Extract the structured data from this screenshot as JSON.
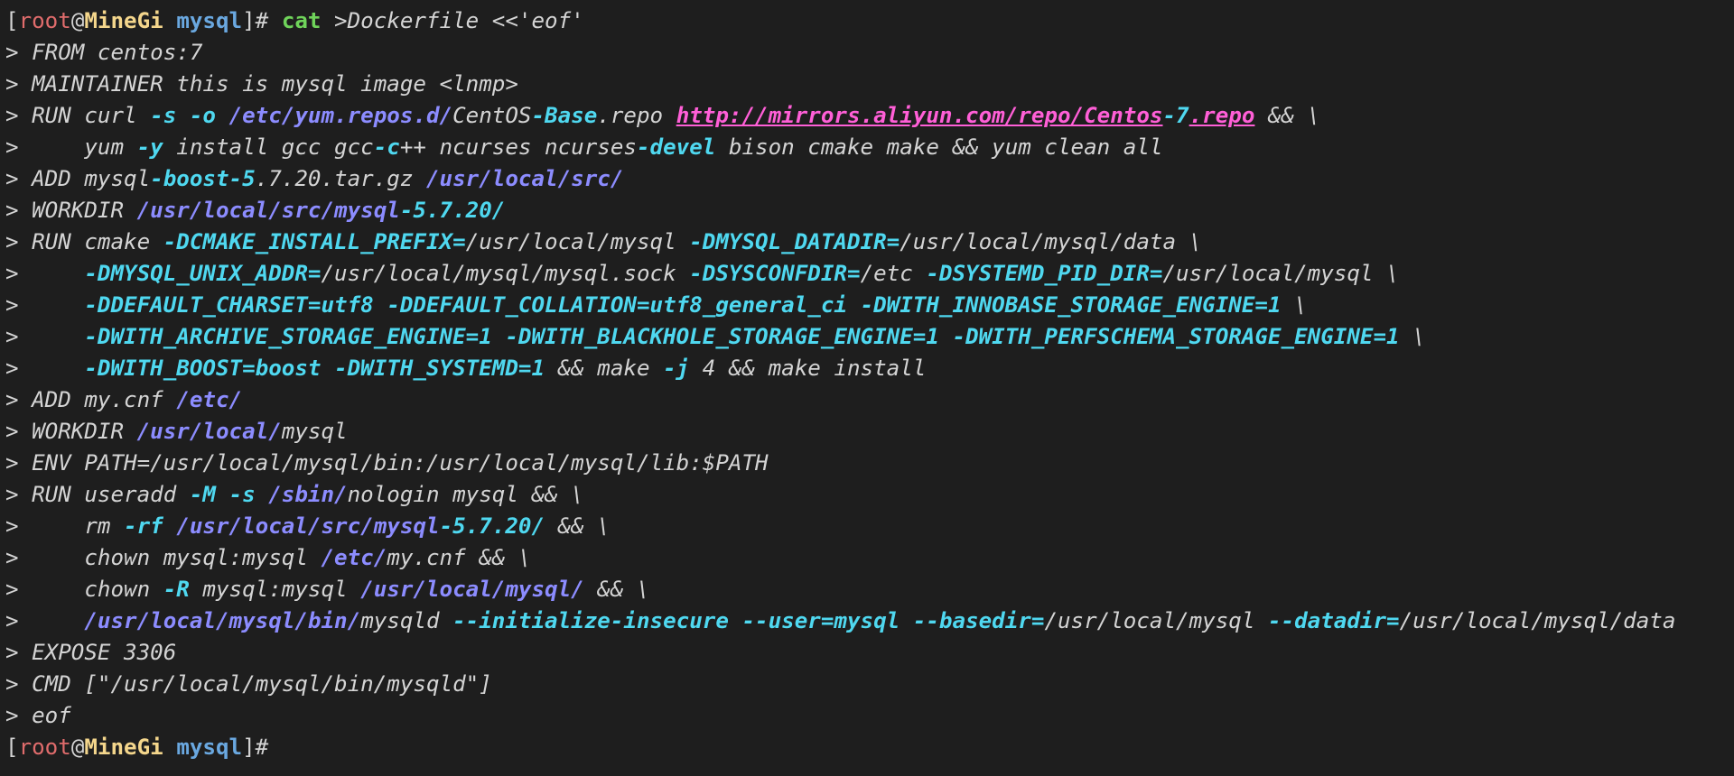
{
  "terminal": {
    "lines": [
      [
        [
          "br",
          "["
        ],
        [
          "r",
          "root"
        ],
        [
          "w",
          "@"
        ],
        [
          "y",
          "MineGi"
        ],
        [
          "w",
          " "
        ],
        [
          "b",
          "mysql"
        ],
        [
          "br",
          "]# "
        ],
        [
          "g",
          "cat"
        ],
        [
          "t",
          " >Dockerfile <<'eof'"
        ]
      ],
      [
        [
          "t",
          "> FROM centos:7"
        ]
      ],
      [
        [
          "t",
          "> MAINTAINER this is mysql image <lnmp>"
        ]
      ],
      [
        [
          "t",
          "> RUN curl "
        ],
        [
          "c",
          "-s"
        ],
        [
          "t",
          " "
        ],
        [
          "c",
          "-o"
        ],
        [
          "t",
          " "
        ],
        [
          "p",
          "/etc/yum.repos.d/"
        ],
        [
          "t",
          "CentOS"
        ],
        [
          "c",
          "-Base"
        ],
        [
          "t",
          ".repo "
        ],
        [
          "m",
          "http://mirrors.aliyun.com/repo/Centos"
        ],
        [
          "c",
          "-7"
        ],
        [
          "m",
          ".repo"
        ],
        [
          "t",
          " && \\"
        ]
      ],
      [
        [
          "t",
          ">     yum "
        ],
        [
          "c",
          "-y"
        ],
        [
          "t",
          " install gcc gcc"
        ],
        [
          "c",
          "-c"
        ],
        [
          "t",
          "++ ncurses ncurses"
        ],
        [
          "c",
          "-devel"
        ],
        [
          "t",
          " bison cmake make && yum clean all"
        ]
      ],
      [
        [
          "t",
          "> ADD mysql"
        ],
        [
          "c",
          "-boost-5"
        ],
        [
          "t",
          ".7.20.tar.gz "
        ],
        [
          "p",
          "/usr/local/src/"
        ]
      ],
      [
        [
          "t",
          "> WORKDIR "
        ],
        [
          "p",
          "/usr/local/src/mysql"
        ],
        [
          "c",
          "-5.7.20/"
        ]
      ],
      [
        [
          "t",
          "> RUN cmake "
        ],
        [
          "c",
          "-DCMAKE_INSTALL_PREFIX="
        ],
        [
          "t",
          "/usr/local/mysql "
        ],
        [
          "c",
          "-DMYSQL_DATADIR="
        ],
        [
          "t",
          "/usr/local/mysql/data \\"
        ]
      ],
      [
        [
          "t",
          ">     "
        ],
        [
          "c",
          "-DMYSQL_UNIX_ADDR="
        ],
        [
          "t",
          "/usr/local/mysql/mysql.sock "
        ],
        [
          "c",
          "-DSYSCONFDIR="
        ],
        [
          "t",
          "/etc "
        ],
        [
          "c",
          "-DSYSTEMD_PID_DIR="
        ],
        [
          "t",
          "/usr/local/mysql \\"
        ]
      ],
      [
        [
          "t",
          ">     "
        ],
        [
          "c",
          "-DDEFAULT_CHARSET=utf8"
        ],
        [
          "t",
          " "
        ],
        [
          "c",
          "-DDEFAULT_COLLATION=utf8_general_ci"
        ],
        [
          "t",
          " "
        ],
        [
          "c",
          "-DWITH_INNOBASE_STORAGE_ENGINE=1"
        ],
        [
          "t",
          " \\"
        ]
      ],
      [
        [
          "t",
          ">     "
        ],
        [
          "c",
          "-DWITH_ARCHIVE_STORAGE_ENGINE=1"
        ],
        [
          "t",
          " "
        ],
        [
          "c",
          "-DWITH_BLACKHOLE_STORAGE_ENGINE=1"
        ],
        [
          "t",
          " "
        ],
        [
          "c",
          "-DWITH_PERFSCHEMA_STORAGE_ENGINE=1"
        ],
        [
          "t",
          " \\"
        ]
      ],
      [
        [
          "t",
          ">     "
        ],
        [
          "c",
          "-DWITH_BOOST=boost"
        ],
        [
          "t",
          " "
        ],
        [
          "c",
          "-DWITH_SYSTEMD=1"
        ],
        [
          "t",
          " && make "
        ],
        [
          "c",
          "-j"
        ],
        [
          "t",
          " 4 && make install"
        ]
      ],
      [
        [
          "t",
          "> ADD my.cnf "
        ],
        [
          "p",
          "/etc/"
        ]
      ],
      [
        [
          "t",
          "> WORKDIR "
        ],
        [
          "p",
          "/usr/local/"
        ],
        [
          "t",
          "mysql"
        ]
      ],
      [
        [
          "t",
          "> ENV PATH=/usr/local/mysql/bin:/usr/local/mysql/lib:$PATH"
        ]
      ],
      [
        [
          "t",
          "> RUN useradd "
        ],
        [
          "c",
          "-M"
        ],
        [
          "t",
          " "
        ],
        [
          "c",
          "-s"
        ],
        [
          "t",
          " "
        ],
        [
          "p",
          "/sbin/"
        ],
        [
          "t",
          "nologin mysql && \\"
        ]
      ],
      [
        [
          "t",
          ">     rm "
        ],
        [
          "c",
          "-rf"
        ],
        [
          "t",
          " "
        ],
        [
          "p",
          "/usr/local/src/mysql"
        ],
        [
          "c",
          "-5.7.20/"
        ],
        [
          "t",
          " && \\"
        ]
      ],
      [
        [
          "t",
          ">     chown mysql:mysql "
        ],
        [
          "p",
          "/etc/"
        ],
        [
          "t",
          "my.cnf && \\"
        ]
      ],
      [
        [
          "t",
          ">     chown "
        ],
        [
          "c",
          "-R"
        ],
        [
          "t",
          " mysql:mysql "
        ],
        [
          "p",
          "/usr/local/mysql/"
        ],
        [
          "t",
          " && \\"
        ]
      ],
      [
        [
          "t",
          ">     "
        ],
        [
          "p",
          "/usr/local/mysql/bin/"
        ],
        [
          "t",
          "mysqld "
        ],
        [
          "c",
          "--initialize-insecure"
        ],
        [
          "t",
          " "
        ],
        [
          "c",
          "--user=mysql"
        ],
        [
          "t",
          " "
        ],
        [
          "c",
          "--basedir="
        ],
        [
          "t",
          "/usr/local/mysql "
        ],
        [
          "c",
          "--datadir="
        ],
        [
          "t",
          "/usr/local/mysql/data"
        ]
      ],
      [
        [
          "t",
          "> EXPOSE 3306"
        ]
      ],
      [
        [
          "t",
          "> CMD [\"/usr/local/mysql/bin/mysqld\"]"
        ]
      ],
      [
        [
          "t",
          "> eof"
        ]
      ],
      [
        [
          "br",
          "["
        ],
        [
          "r",
          "root"
        ],
        [
          "w",
          "@"
        ],
        [
          "y",
          "MineGi"
        ],
        [
          "w",
          " "
        ],
        [
          "b",
          "mysql"
        ],
        [
          "br",
          "]#"
        ]
      ]
    ]
  }
}
